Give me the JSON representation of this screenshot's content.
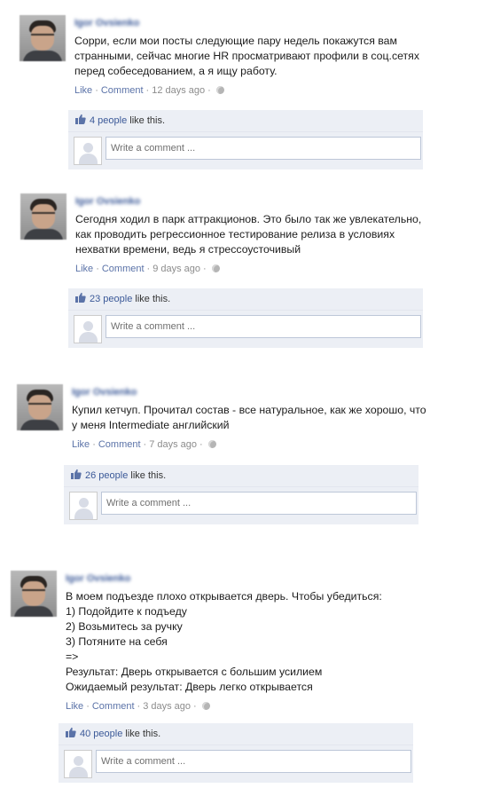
{
  "posts": [
    {
      "author": "Igor Ovsienko",
      "lines": [
        "Сорри, если мои посты следующие пару недель покажутся вам",
        "странными, сейчас многие HR просматривают профили в соц.сетях",
        "перед собеседованием, а я ищу работу."
      ],
      "like_label": "Like",
      "comment_label": "Comment",
      "time": "12 days ago",
      "like_count": "4 people",
      "like_suffix": "like this.",
      "comment_placeholder": "Write a comment ..."
    },
    {
      "author": "Igor Ovsienko",
      "lines": [
        "Сегодня ходил в парк аттракционов. Это было так же увлекательно,",
        "как проводить регрессионное тестирование релиза в условиях",
        "нехватки времени, ведь я стрессоусточивый"
      ],
      "like_label": "Like",
      "comment_label": "Comment",
      "time": "9 days ago",
      "like_count": "23 people",
      "like_suffix": "like this.",
      "comment_placeholder": "Write a comment ..."
    },
    {
      "author": "Igor Ovsienko",
      "lines": [
        "Купил кетчуп. Прочитал состав - все натуральное, как же хорошо, что",
        "у меня Intermediate английский"
      ],
      "like_label": "Like",
      "comment_label": "Comment",
      "time": "7 days ago",
      "like_count": "26 people",
      "like_suffix": "like this.",
      "comment_placeholder": "Write a comment ..."
    },
    {
      "author": "Igor Ovsienko",
      "lines": [
        "В моем подъезде плохо открывается дверь. Чтобы убедиться:",
        "1) Подойдите к подъеду",
        "2) Возьмитесь за ручку",
        "3) Потяните на себя",
        "=>",
        "Результат: Дверь открывается с большим усилием",
        "Ожидаемый результат: Дверь легко открывается"
      ],
      "like_label": "Like",
      "comment_label": "Comment",
      "time": "3 days ago",
      "like_count": "40 people",
      "like_suffix": "like this.",
      "comment_placeholder": "Write a comment ..."
    }
  ],
  "colors": {
    "link": "#3b5998",
    "meta": "#8c8c8c",
    "likes_bg": "#eceff5"
  }
}
